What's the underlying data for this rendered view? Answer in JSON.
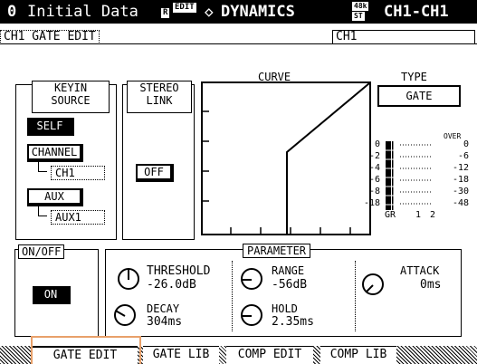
{
  "header": {
    "scene_number": "0",
    "scene_name": "Initial Data",
    "lock_icon_label": "R",
    "edit_badge": "EDIT",
    "diamond_symbol": "◇",
    "section_title": "DYNAMICS",
    "rate_top": "48k",
    "rate_bottom": "ST",
    "channel_range": "CH1-CH1"
  },
  "subheader": {
    "page_label": "CH1 GATE EDIT",
    "channel_label": "CH1"
  },
  "keyin": {
    "title_line1": "KEYIN",
    "title_line2": "SOURCE",
    "self_label": "SELF",
    "channel_label": "CHANNEL",
    "channel_value": "CH1",
    "aux_label": "AUX",
    "aux_value": "AUX1"
  },
  "stereo_link": {
    "title_line1": "STEREO",
    "title_line2": "LINK",
    "value": "OFF"
  },
  "curve": {
    "title": "CURVE"
  },
  "type": {
    "title": "TYPE",
    "value": "GATE"
  },
  "meter": {
    "over_label": "OVER",
    "left_scale": [
      "0",
      "-2",
      "-4",
      "-6",
      "-8",
      "-18"
    ],
    "right_scale": [
      "0",
      "-6",
      "-12",
      "-18",
      "-30",
      "-48"
    ],
    "gr_label": "GR",
    "ch_labels": [
      "1",
      "2"
    ]
  },
  "onoff": {
    "title": "ON/OFF",
    "value": "ON"
  },
  "parameter": {
    "title": "PARAMETER",
    "threshold_label": "THRESHOLD",
    "threshold_value": "-26.0dB",
    "range_label": "RANGE",
    "range_value": "-56dB",
    "attack_label": "ATTACK",
    "attack_value": "0ms",
    "decay_label": "DECAY",
    "decay_value": "304ms",
    "hold_label": "HOLD",
    "hold_value": "2.35ms"
  },
  "tabs": [
    {
      "label": "GATE EDIT",
      "active": true
    },
    {
      "label": "GATE LIB",
      "active": false
    },
    {
      "label": "COMP EDIT",
      "active": false
    },
    {
      "label": "COMP LIB",
      "active": false
    }
  ],
  "colors": {
    "highlight": "#e8a06a",
    "background": "#ffffff",
    "ink": "#000000"
  }
}
